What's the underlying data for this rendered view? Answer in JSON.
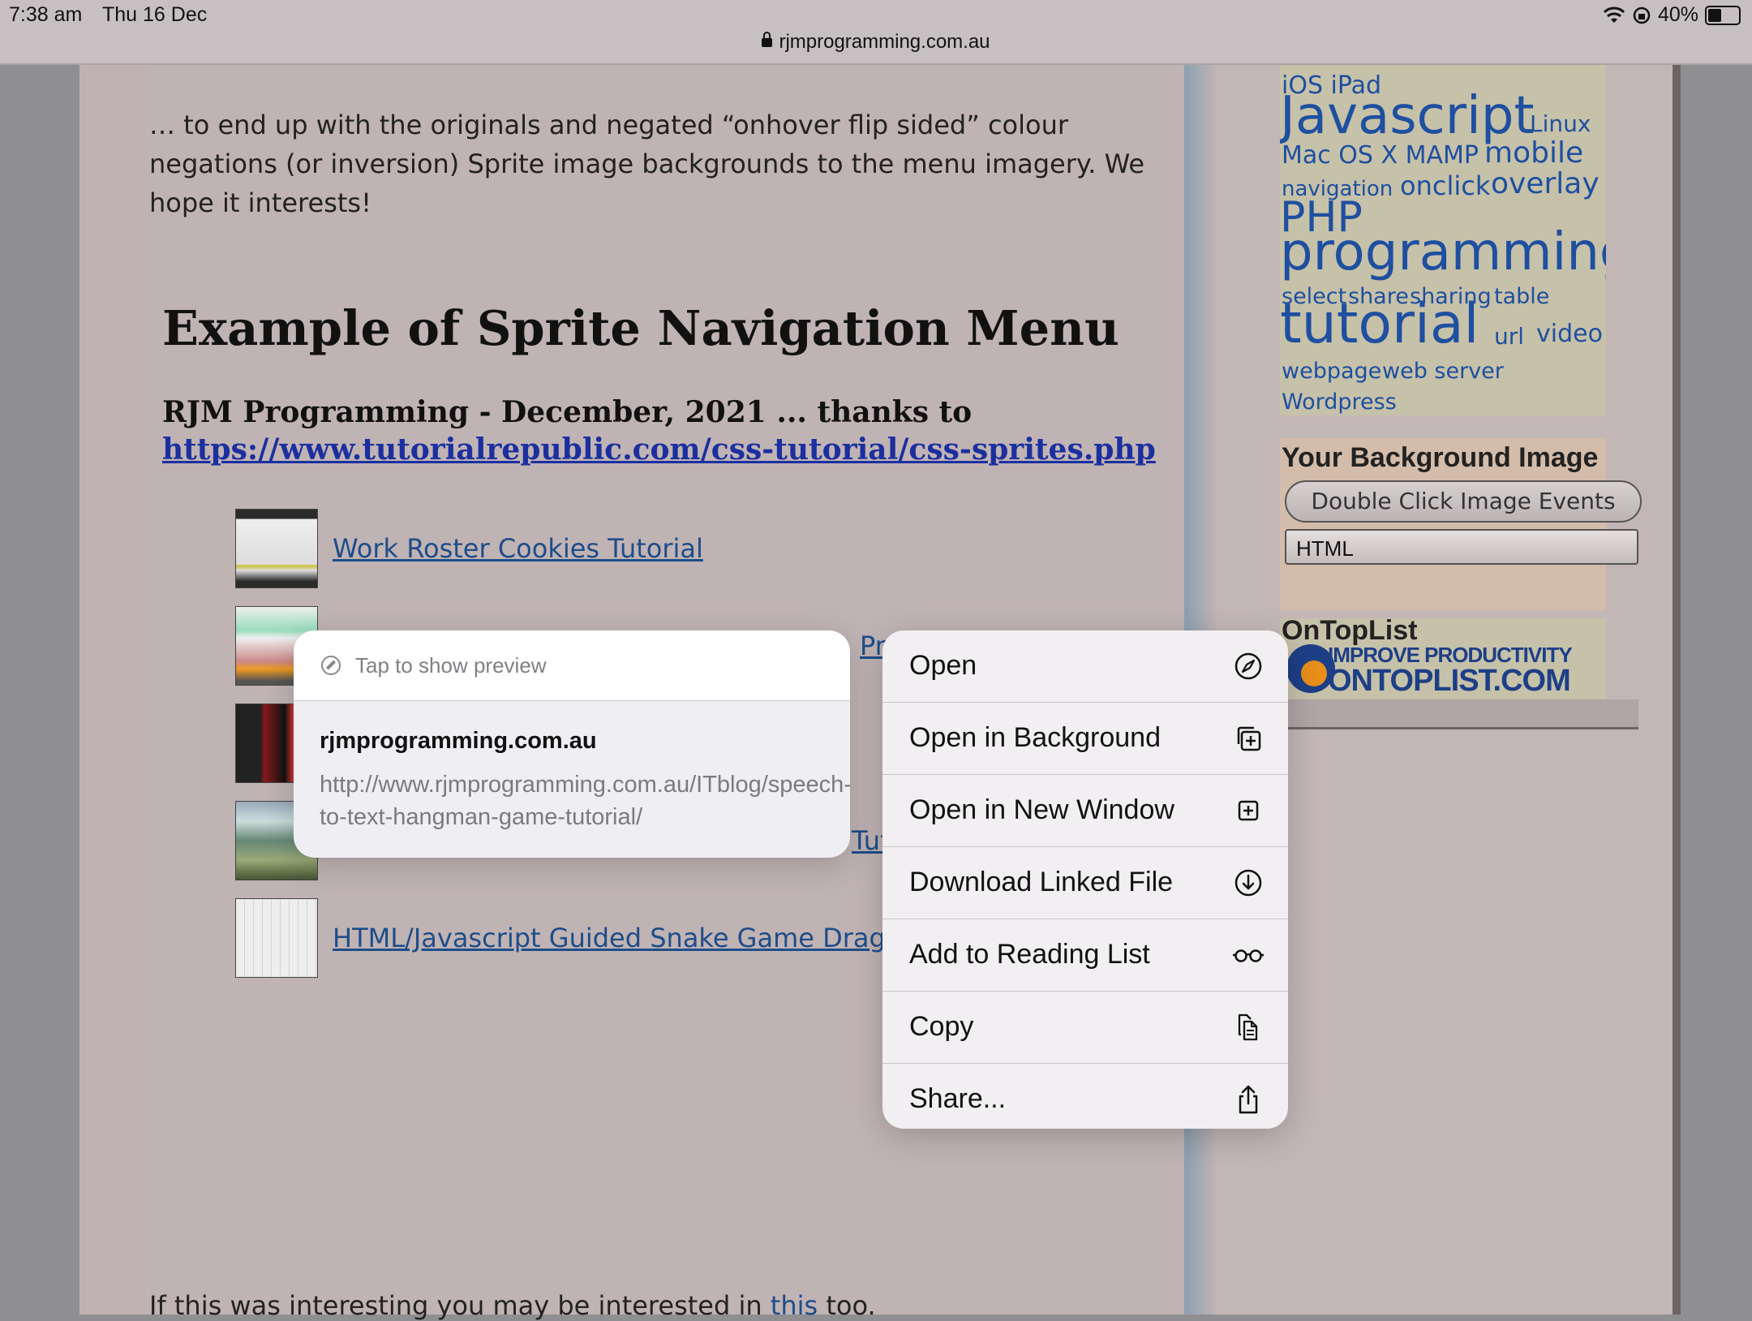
{
  "status_bar": {
    "time": "7:38 am",
    "date": "Thu 16 Dec",
    "url": "rjmprogramming.com.au",
    "battery": "40%"
  },
  "article": {
    "intro": "… to end up with the originals and negated “onhover flip sided” colour negations (or inversion) Sprite image backgrounds to the menu imagery. We hope it interests!",
    "heading": "Example of Sprite Navigation Menu",
    "byline": "RJM Programming - December, 2021 ... thanks to",
    "byline_link": "https://www.tutorialrepublic.com/css-tutorial/css-sprites.php",
    "items": [
      {
        "label": "Work Roster Cookies Tutorial"
      },
      {
        "label": "Pr"
      },
      {
        "label": ""
      },
      {
        "label": "Tut"
      },
      {
        "label": "HTML/Javascript Guided Snake Game Drag an"
      }
    ],
    "footer_prefix": "If this was interesting you may be interested in",
    "footer_link": "this",
    "footer_suffix": "too."
  },
  "sidebar": {
    "tags": {
      "ios_ipad": "iOS iPad",
      "javascript": "Javascript",
      "linux": "Linux",
      "mac": "Mac OS X MAMP",
      "mobile": "mobile",
      "navigation": "navigation",
      "onclick": "onclick",
      "overlay": "overlay",
      "php": "PHP",
      "programming": "programming",
      "select": "select",
      "share": "share",
      "sharing": "sharing",
      "table": "table",
      "tutorial": "tutorial",
      "url": "url",
      "video": "video",
      "webpage": "webpage",
      "webserver": "web server",
      "wordpress": "Wordpress"
    },
    "bg_title": "Your Background Image",
    "bg_button": "Double Click Image Events",
    "bg_select": "HTML",
    "ontoplist_title": "OnTopList",
    "ontoplist_line1": "IMPROVE PRODUCTIVITY",
    "ontoplist_line2": "ONTOPLIST.COM"
  },
  "preview": {
    "hint": "Tap to show preview",
    "domain": "rjmprogramming.com.au",
    "url": "http://www.rjmprogramming.com.au/ITblog/speech-to-text-hangman-game-tutorial/"
  },
  "menu": {
    "items": [
      {
        "label": "Open",
        "icon": "compass-icon"
      },
      {
        "label": "Open in Background",
        "icon": "open-background-icon"
      },
      {
        "label": "Open in New Window",
        "icon": "new-window-icon"
      },
      {
        "label": "Download Linked File",
        "icon": "download-icon"
      },
      {
        "label": "Add to Reading List",
        "icon": "glasses-icon"
      },
      {
        "label": "Copy",
        "icon": "copy-icon"
      },
      {
        "label": "Share...",
        "icon": "share-icon"
      }
    ]
  }
}
